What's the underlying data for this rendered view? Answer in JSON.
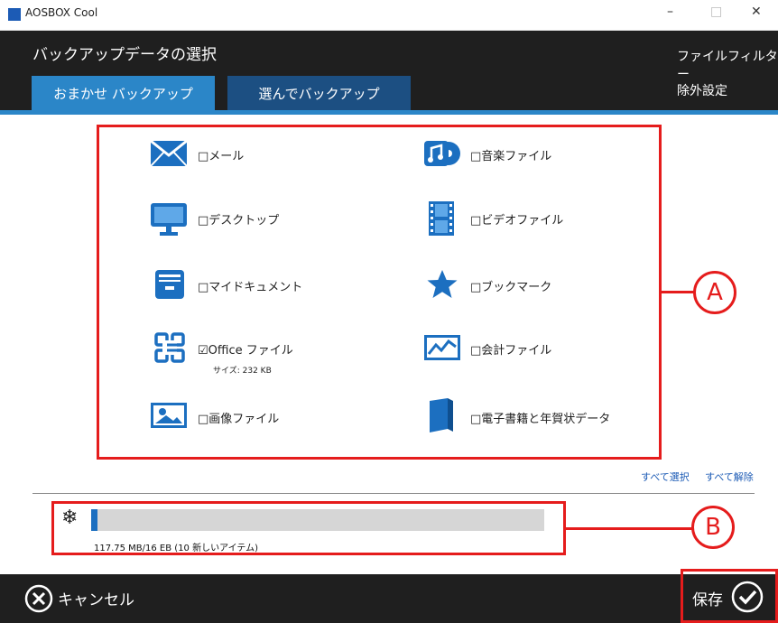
{
  "window": {
    "title": "AOSBOX Cool",
    "minimize": "–",
    "maximize": "□",
    "close": "✕"
  },
  "header": {
    "title": "バックアップデータの選択",
    "file_filter": "ファイルフィルター",
    "exclude_settings": "除外設定"
  },
  "tabs": [
    {
      "label": "おまかせ バックアップ",
      "active": true
    },
    {
      "label": "選んでバックアップ",
      "active": false
    }
  ],
  "items": [
    {
      "label": "□メール",
      "icon": "mail-icon",
      "checked": false
    },
    {
      "label": "□音楽ファイル",
      "icon": "music-icon",
      "checked": false
    },
    {
      "label": "□デスクトップ",
      "icon": "monitor-icon",
      "checked": false
    },
    {
      "label": "□ビデオファイル",
      "icon": "film-icon",
      "checked": false
    },
    {
      "label": "□マイドキュメント",
      "icon": "cabinet-icon",
      "checked": false
    },
    {
      "label": "□ブックマーク",
      "icon": "star-icon",
      "checked": false
    },
    {
      "label": "☑Office ファイル",
      "icon": "office-icon",
      "checked": true,
      "size": "サイズ: 232 KB"
    },
    {
      "label": "□会計ファイル",
      "icon": "chart-icon",
      "checked": false
    },
    {
      "label": "□画像ファイル",
      "icon": "image-icon",
      "checked": false
    },
    {
      "label": "□電子書籍と年賀状データ",
      "icon": "book-icon",
      "checked": false
    }
  ],
  "select_all": "すべて選択",
  "deselect_all": "すべて解除",
  "storage": {
    "text": "117.75 MB/16 EB (10 新しいアイテム)",
    "progress_percent": 1.4
  },
  "callouts": {
    "a": "A",
    "b": "B"
  },
  "footer": {
    "cancel": "キャンセル",
    "save": "保存"
  },
  "colors": {
    "accent": "#2b86c8",
    "dark": "#1f1f1f",
    "highlight": "#e51c1c",
    "icon_blue": "#1c6fc0"
  }
}
